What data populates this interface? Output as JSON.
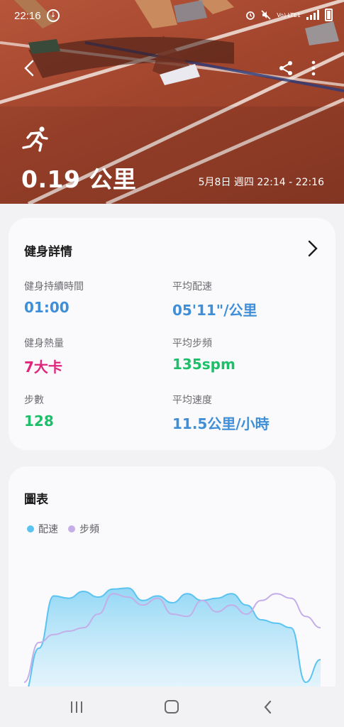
{
  "status_bar": {
    "time": "22:16",
    "download_icon": "download-icon",
    "alarm_icon": "alarm-icon",
    "mute_icon": "mute-icon",
    "network_label": "Vo) LTE1",
    "signal_icon": "signal-icon",
    "battery_icon": "battery-icon"
  },
  "hero": {
    "distance": "0.19 公里",
    "datetime": "5月8日 週四 22:14 - 22:16",
    "activity_icon": "running-icon"
  },
  "details": {
    "title": "健身詳情",
    "metrics": [
      {
        "label": "健身持續時間",
        "value": "01:00",
        "color": "#3f8fd8"
      },
      {
        "label": "平均配速",
        "value": "05'11\"/公里",
        "color": "#3f8fd8"
      },
      {
        "label": "健身熱量",
        "value": "7大卡",
        "color": "#e0257a"
      },
      {
        "label": "平均步頻",
        "value": "135spm",
        "color": "#1ebf6a"
      },
      {
        "label": "步數",
        "value": "128",
        "color": "#1ebf6a"
      },
      {
        "label": "平均速度",
        "value": "11.5公里/小時",
        "color": "#3f8fd8"
      }
    ]
  },
  "chart": {
    "title": "圖表",
    "legend": [
      {
        "label": "配速",
        "color": "#5bc3f0"
      },
      {
        "label": "步頻",
        "color": "#c3aee8"
      }
    ]
  },
  "chart_data": {
    "type": "area",
    "title": "圖表",
    "xlabel": "",
    "ylabel": "",
    "x": [
      0,
      5,
      10,
      15,
      20,
      25,
      30,
      35,
      40,
      45,
      50,
      55,
      60,
      65,
      70,
      75,
      80,
      85,
      90,
      95,
      100
    ],
    "series": [
      {
        "name": "配速",
        "values": [
          0,
          40,
          86,
          84,
          90,
          85,
          92,
          93,
          82,
          86,
          80,
          88,
          82,
          84,
          88,
          78,
          65,
          62,
          58,
          10,
          30
        ]
      },
      {
        "name": "步頻",
        "values": [
          10,
          45,
          52,
          55,
          58,
          70,
          88,
          85,
          78,
          84,
          70,
          68,
          82,
          72,
          78,
          70,
          82,
          88,
          84,
          68,
          58
        ]
      }
    ],
    "legend": [
      "配速",
      "步頻"
    ],
    "grid": false
  },
  "navbar": {
    "recents_icon": "recents-icon",
    "home_icon": "home-icon",
    "back_icon": "back-icon"
  }
}
